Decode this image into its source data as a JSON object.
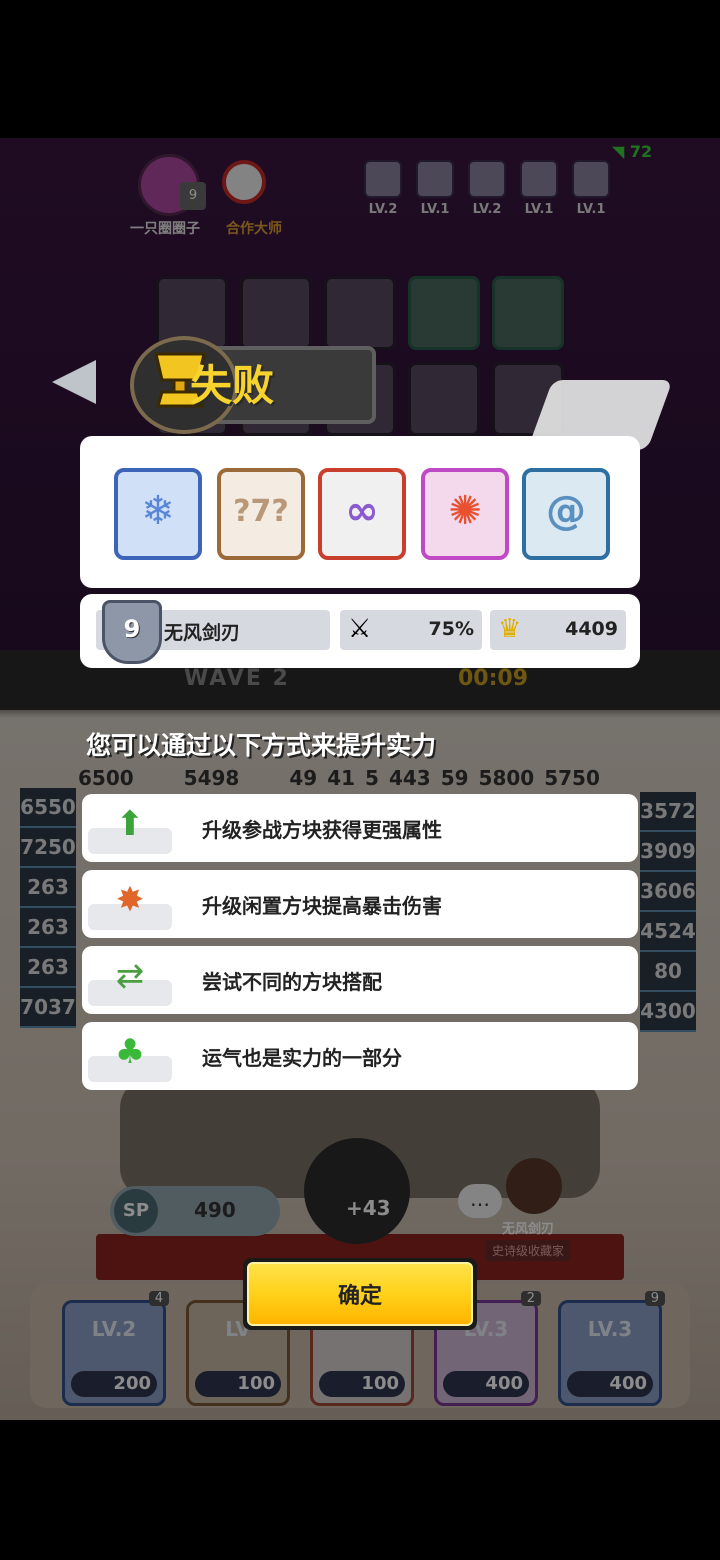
{
  "status_bar": {
    "signal_text": "72"
  },
  "background_game": {
    "player_name": "一只圈圈子",
    "partner_name": "合作大师",
    "player_level": "9",
    "top_levels": [
      "LV.2",
      "LV.1",
      "LV.2",
      "LV.1",
      "LV.1"
    ],
    "wave": "WAVE 2",
    "timer": "00:09",
    "top_numbers": [
      "6500",
      "5498",
      "49",
      "41",
      "5",
      "443",
      "59",
      "5800",
      "5750"
    ],
    "left_column": [
      "6550",
      "7250",
      "263",
      "263",
      "263",
      "7037"
    ],
    "right_column": [
      "3572",
      "3909",
      "3606",
      "4524",
      "80",
      "4300"
    ],
    "sp_label": "SP",
    "sp_value": "490",
    "dice_bonus": "+43",
    "opponent_name": "无风剑刃",
    "opponent_title": "史诗级收藏家",
    "opponent_level": "9",
    "bottom_cards": [
      {
        "level": "LV.2",
        "cost": "200",
        "count": "4"
      },
      {
        "level": "LV",
        "cost": "100",
        "count": ""
      },
      {
        "level": "",
        "cost": "100",
        "count": ""
      },
      {
        "level": "LV.3",
        "cost": "400",
        "count": "2"
      },
      {
        "level": "LV.3",
        "cost": "400",
        "count": "9"
      }
    ]
  },
  "result_dialog": {
    "title": "失败",
    "deck_cards": [
      {
        "name": "ice-dice",
        "icon": "snowflake-icon",
        "color": "#3c64b8"
      },
      {
        "name": "mystery-dice",
        "icon": "question-icon",
        "color": "#9c6a38"
      },
      {
        "name": "infinity-dice",
        "icon": "infinity-icon",
        "color": "#c93e2c"
      },
      {
        "name": "sun-dice",
        "icon": "sun-icon",
        "color": "#c04ac6"
      },
      {
        "name": "wind-dice",
        "icon": "swirl-icon",
        "color": "#2d6fa0"
      }
    ],
    "stats": {
      "rank_level": "9",
      "player_name": "无风剑刃",
      "crit_rate": "75%",
      "gold": "4409"
    },
    "hint_heading": "您可以通过以下方式来提升实力",
    "tips": [
      {
        "icon": "upgrade-cube-icon",
        "text": "升级参战方块获得更强属性"
      },
      {
        "icon": "crit-burst-icon",
        "text": "升级闲置方块提高暴击伤害"
      },
      {
        "icon": "swap-cubes-icon",
        "text": "尝试不同的方块搭配"
      },
      {
        "icon": "clover-icon",
        "text": "运气也是实力的一部分"
      }
    ],
    "confirm_label": "确定"
  },
  "colors": {
    "accent_yellow": "#ffd21a",
    "title_yellow": "#f7d32d"
  }
}
